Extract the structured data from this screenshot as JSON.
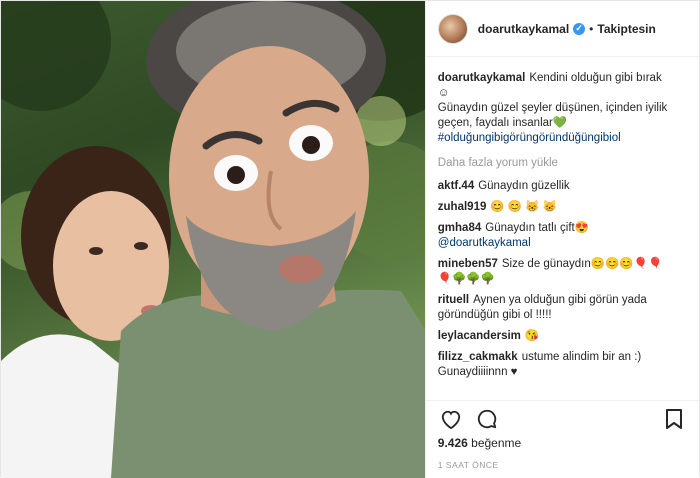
{
  "header": {
    "username": "doarutkaykamal",
    "verified_badge": "✓",
    "separator": "•",
    "follow_label": "Takiptesin"
  },
  "caption": {
    "username": "doarutkaykamal",
    "line1": "Kendini olduğun gibi bırak",
    "emoji1": "☺",
    "line2": "Günaydın güzel şeyler düşünen, içinden iyilik geçen, faydalı insanlar",
    "emoji2": "💚",
    "hashtag": "#olduğungibigörüngöründüğüngibiol"
  },
  "more_comments_label": "Daha fazla yorum yükle",
  "comments": [
    {
      "user": "aktf.44",
      "text": "Günaydın güzellik"
    },
    {
      "user": "zuhal919",
      "text": "😊 😊 😸 😸"
    },
    {
      "user": "gmha84",
      "text": "Günaydın tatlı çift😍",
      "mention": "@doarutkaykamal"
    },
    {
      "user": "mineben57",
      "text": "Size de günaydın😊😊😊🎈🎈",
      "text2": "🎈🌳🌳🌳"
    },
    {
      "user": "rituell",
      "text": "Aynen ya olduğun gibi görün yada göründüğün gibi ol !!!!!"
    },
    {
      "user": "leylacandersim",
      "text": "😘"
    },
    {
      "user": "filizz_cakmakk",
      "text": "ustume alindim bir an :) Gunaydiiiinnn ♥"
    }
  ],
  "likes": {
    "count": "9.426",
    "label": "beğenme"
  },
  "timestamp": "1 SAAT ÖNCE",
  "icons": {
    "like": "heart-icon",
    "comment": "comment-icon",
    "save": "bookmark-icon"
  }
}
